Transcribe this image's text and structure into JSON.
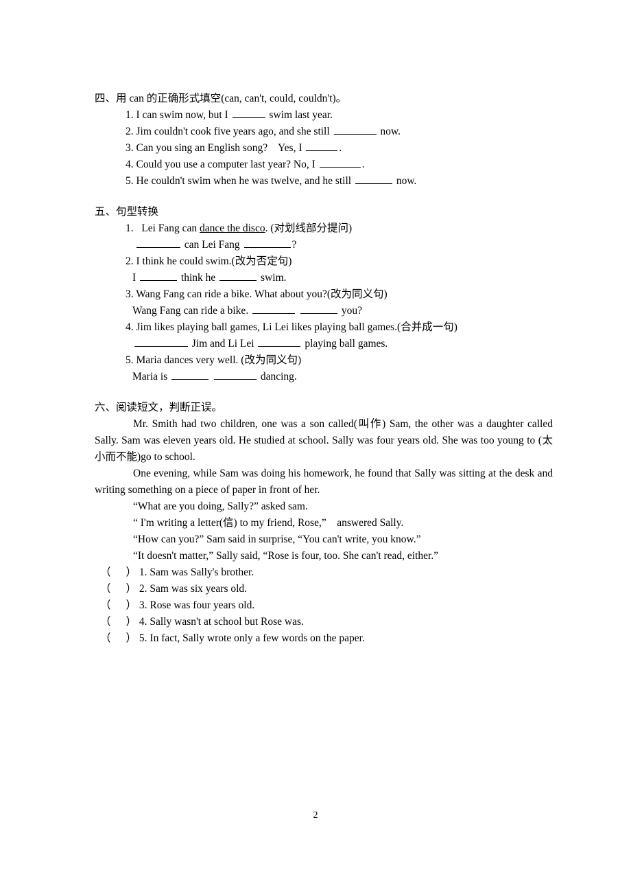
{
  "page": {
    "number": "2"
  },
  "section4": {
    "heading": "四、用 can 的正确形式填空(can, can't, could, couldn't)。",
    "items": [
      {
        "pre": "1. I can swim now, but I ",
        "blank1": 48,
        "post": " swim last year."
      },
      {
        "pre": "2. Jim couldn't cook five years ago, and she still ",
        "blank1": 62,
        "post": " now."
      },
      {
        "pre": "3. Can you sing an English song?    Yes, I ",
        "blank1": 46,
        "post": "."
      },
      {
        "pre": "4. Could you use a computer last year? No, I ",
        "blank1": 60,
        "post": "."
      },
      {
        "pre": "5. He couldn't swim when he was twelve, and he still ",
        "blank1": 54,
        "post": " now."
      }
    ]
  },
  "section5": {
    "heading": "五、句型转换",
    "q1": {
      "line1_a": "1.   Lei Fang can ",
      "line1_underlined": "dance the disco",
      "line1_b": ". (对划线部分提问)",
      "line2_a": " ",
      "line2_blank1": 64,
      "line2_b": " can Lei Fang ",
      "line2_blank2": 68,
      "line2_c": "?"
    },
    "q2": {
      "line1": "2. I think he could swim.(改为否定句)",
      "line2_a": "I ",
      "line2_blank1": 54,
      "line2_b": " think he ",
      "line2_blank2": 54,
      "line2_c": " swim."
    },
    "q3": {
      "line1": "3. Wang Fang can ride a bike. What about you?(改为同义句)",
      "line2_a": "Wang Fang can ride a bike. ",
      "line2_blank1": 62,
      "line2_mid": " ",
      "line2_blank2": 54,
      "line2_b": " you?"
    },
    "q4": {
      "line1": "4. Jim likes playing ball games, Li Lei likes playing ball games.(合并成一句)",
      "line2_a": " ",
      "line2_blank1": 78,
      "line2_b": " Jim and Li Lei ",
      "line2_blank2": 62,
      "line2_c": " playing ball games."
    },
    "q5": {
      "line1": "5. Maria dances very well. (改为同义句)",
      "line2_a": "Maria is ",
      "line2_blank1": 54,
      "line2_mid": " ",
      "line2_blank2": 62,
      "line2_b": " dancing."
    }
  },
  "section6": {
    "heading": "六、阅读短文，判断正误。",
    "paragraphs": [
      "Mr. Smith had two children, one was a son called(叫作) Sam, the other was a daughter called Sally. Sam was eleven years old. He studied at school. Sally was four years old. She was too young to (太小而不能)go to school.",
      "One evening, while Sam was doing his homework, he found that Sally was sitting at the desk and writing something on a piece of paper in front of her."
    ],
    "quotes": [
      "“What are you doing, Sally?” asked sam.",
      "“ I'm writing a letter(信) to my friend, Rose,”    answered Sally.",
      "“How can you?” Sam said in surprise, “You can't write, you know.”",
      "“It doesn't matter,” Sally said, “Rose is four, too. She can't read, either.”"
    ],
    "tf_open": "（",
    "tf_close": "）",
    "tf_items": [
      "1. Sam was Sally's brother.",
      "2. Sam was six years old.",
      "3. Rose was four years old.",
      "4. Sally wasn't at school but Rose was.",
      "5. In fact, Sally wrote only a few words on the paper."
    ]
  }
}
